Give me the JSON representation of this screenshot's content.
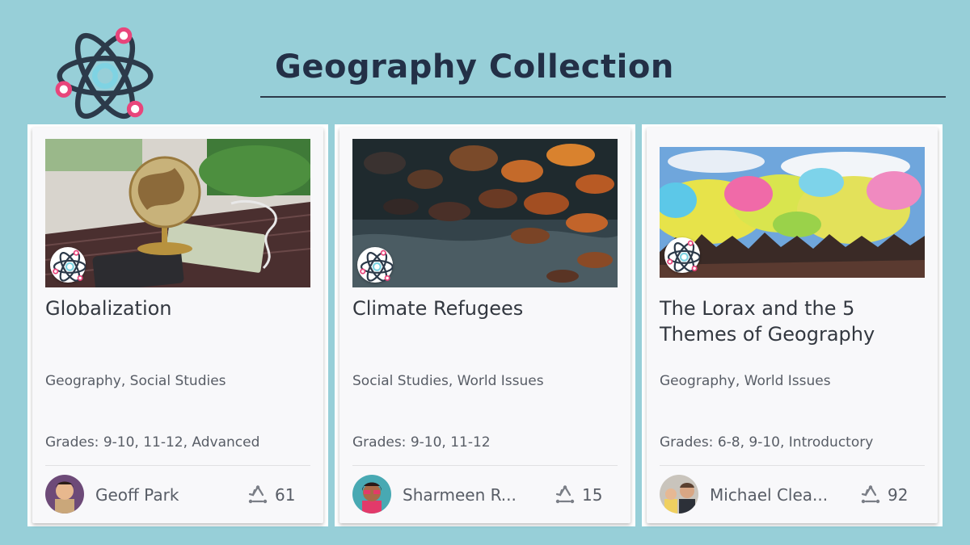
{
  "header": {
    "title": "Geography Collection"
  },
  "icons": {
    "logo": "atom-logo-icon",
    "badge": "atom-badge-icon",
    "remix": "remix-icon"
  },
  "colors": {
    "background": "#97cfd8",
    "title": "#233047",
    "accent_pink": "#e8457b",
    "accent_teal": "#7fd3e3"
  },
  "cards": [
    {
      "title": "Globalization",
      "subjects": "Geography, Social Studies",
      "grades": "Grades:  9-10, 11-12, Advanced",
      "author": "Geoff Park",
      "count": "61",
      "image": "globe-on-table-with-money-and-phone"
    },
    {
      "title": "Climate Refugees",
      "subjects": "Social Studies, World Issues",
      "grades": "Grades:  9-10, 11-12",
      "author": "Sharmeen R...",
      "count": "15",
      "image": "rocks-in-water"
    },
    {
      "title": "The Lorax and the 5 Themes of Geography",
      "subjects": "Geography, World Issues",
      "grades": "Grades:  6-8, 9-10, Introductory",
      "author": "Michael Clea...",
      "count": "92",
      "image": "color-powder-festival-crowd"
    }
  ]
}
